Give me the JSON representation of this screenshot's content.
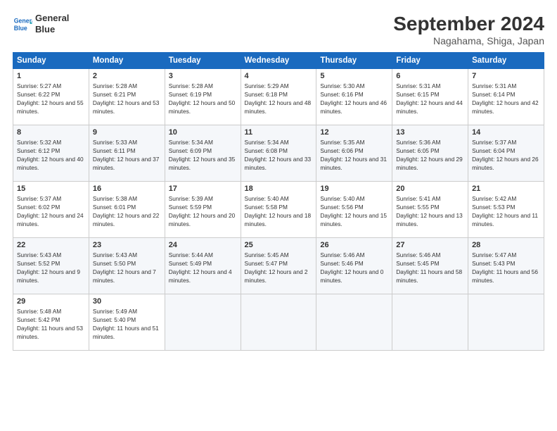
{
  "header": {
    "logo_line1": "General",
    "logo_line2": "Blue",
    "month": "September 2024",
    "location": "Nagahama, Shiga, Japan"
  },
  "weekdays": [
    "Sunday",
    "Monday",
    "Tuesday",
    "Wednesday",
    "Thursday",
    "Friday",
    "Saturday"
  ],
  "weeks": [
    [
      {
        "day": 1,
        "sunrise": "5:27 AM",
        "sunset": "6:22 PM",
        "daylight": "12 hours and 55 minutes."
      },
      {
        "day": 2,
        "sunrise": "5:28 AM",
        "sunset": "6:21 PM",
        "daylight": "12 hours and 53 minutes."
      },
      {
        "day": 3,
        "sunrise": "5:28 AM",
        "sunset": "6:19 PM",
        "daylight": "12 hours and 50 minutes."
      },
      {
        "day": 4,
        "sunrise": "5:29 AM",
        "sunset": "6:18 PM",
        "daylight": "12 hours and 48 minutes."
      },
      {
        "day": 5,
        "sunrise": "5:30 AM",
        "sunset": "6:16 PM",
        "daylight": "12 hours and 46 minutes."
      },
      {
        "day": 6,
        "sunrise": "5:31 AM",
        "sunset": "6:15 PM",
        "daylight": "12 hours and 44 minutes."
      },
      {
        "day": 7,
        "sunrise": "5:31 AM",
        "sunset": "6:14 PM",
        "daylight": "12 hours and 42 minutes."
      }
    ],
    [
      {
        "day": 8,
        "sunrise": "5:32 AM",
        "sunset": "6:12 PM",
        "daylight": "12 hours and 40 minutes."
      },
      {
        "day": 9,
        "sunrise": "5:33 AM",
        "sunset": "6:11 PM",
        "daylight": "12 hours and 37 minutes."
      },
      {
        "day": 10,
        "sunrise": "5:34 AM",
        "sunset": "6:09 PM",
        "daylight": "12 hours and 35 minutes."
      },
      {
        "day": 11,
        "sunrise": "5:34 AM",
        "sunset": "6:08 PM",
        "daylight": "12 hours and 33 minutes."
      },
      {
        "day": 12,
        "sunrise": "5:35 AM",
        "sunset": "6:06 PM",
        "daylight": "12 hours and 31 minutes."
      },
      {
        "day": 13,
        "sunrise": "5:36 AM",
        "sunset": "6:05 PM",
        "daylight": "12 hours and 29 minutes."
      },
      {
        "day": 14,
        "sunrise": "5:37 AM",
        "sunset": "6:04 PM",
        "daylight": "12 hours and 26 minutes."
      }
    ],
    [
      {
        "day": 15,
        "sunrise": "5:37 AM",
        "sunset": "6:02 PM",
        "daylight": "12 hours and 24 minutes."
      },
      {
        "day": 16,
        "sunrise": "5:38 AM",
        "sunset": "6:01 PM",
        "daylight": "12 hours and 22 minutes."
      },
      {
        "day": 17,
        "sunrise": "5:39 AM",
        "sunset": "5:59 PM",
        "daylight": "12 hours and 20 minutes."
      },
      {
        "day": 18,
        "sunrise": "5:40 AM",
        "sunset": "5:58 PM",
        "daylight": "12 hours and 18 minutes."
      },
      {
        "day": 19,
        "sunrise": "5:40 AM",
        "sunset": "5:56 PM",
        "daylight": "12 hours and 15 minutes."
      },
      {
        "day": 20,
        "sunrise": "5:41 AM",
        "sunset": "5:55 PM",
        "daylight": "12 hours and 13 minutes."
      },
      {
        "day": 21,
        "sunrise": "5:42 AM",
        "sunset": "5:53 PM",
        "daylight": "12 hours and 11 minutes."
      }
    ],
    [
      {
        "day": 22,
        "sunrise": "5:43 AM",
        "sunset": "5:52 PM",
        "daylight": "12 hours and 9 minutes."
      },
      {
        "day": 23,
        "sunrise": "5:43 AM",
        "sunset": "5:50 PM",
        "daylight": "12 hours and 7 minutes."
      },
      {
        "day": 24,
        "sunrise": "5:44 AM",
        "sunset": "5:49 PM",
        "daylight": "12 hours and 4 minutes."
      },
      {
        "day": 25,
        "sunrise": "5:45 AM",
        "sunset": "5:47 PM",
        "daylight": "12 hours and 2 minutes."
      },
      {
        "day": 26,
        "sunrise": "5:46 AM",
        "sunset": "5:46 PM",
        "daylight": "12 hours and 0 minutes."
      },
      {
        "day": 27,
        "sunrise": "5:46 AM",
        "sunset": "5:45 PM",
        "daylight": "11 hours and 58 minutes."
      },
      {
        "day": 28,
        "sunrise": "5:47 AM",
        "sunset": "5:43 PM",
        "daylight": "11 hours and 56 minutes."
      }
    ],
    [
      {
        "day": 29,
        "sunrise": "5:48 AM",
        "sunset": "5:42 PM",
        "daylight": "11 hours and 53 minutes."
      },
      {
        "day": 30,
        "sunrise": "5:49 AM",
        "sunset": "5:40 PM",
        "daylight": "11 hours and 51 minutes."
      },
      null,
      null,
      null,
      null,
      null
    ]
  ]
}
